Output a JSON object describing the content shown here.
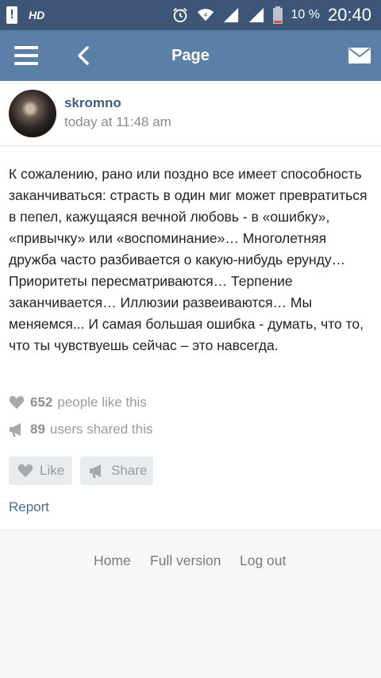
{
  "statusbar": {
    "network": "HD",
    "battery_pct": "10 %",
    "time": "20:40"
  },
  "appbar": {
    "title": "Page"
  },
  "post": {
    "author": "skromno",
    "time": "today at 11:48 am",
    "text": "К сожалению, рано или поздно все имеет способность заканчиваться: страсть в один миг может превратиться в пепел, кажущаяся вечной любовь - в «ошибку», «привычку» или «воспоминание»… Многолетняя дружба часто разбивается о какую-нибудь ерунду… Приоритеты пересматриваются… Терпение заканчивается… Иллюзии развеиваются… Мы меняемся... И самая большая ошибка - думать, что то, что ты чувствуешь сейчас – это навсегда.",
    "likes_count": "652",
    "likes_text": "people like this",
    "shares_count": "89",
    "shares_text": "users shared this",
    "like_label": "Like",
    "share_label": "Share",
    "report_label": "Report"
  },
  "footer": {
    "home": "Home",
    "full_version": "Full version",
    "log_out": "Log out"
  },
  "colors": {
    "statusbar_bg": "#3d5678",
    "appbar_bg": "#5b7fa6",
    "link": "#3f5e83",
    "muted": "#9a9a9a"
  }
}
